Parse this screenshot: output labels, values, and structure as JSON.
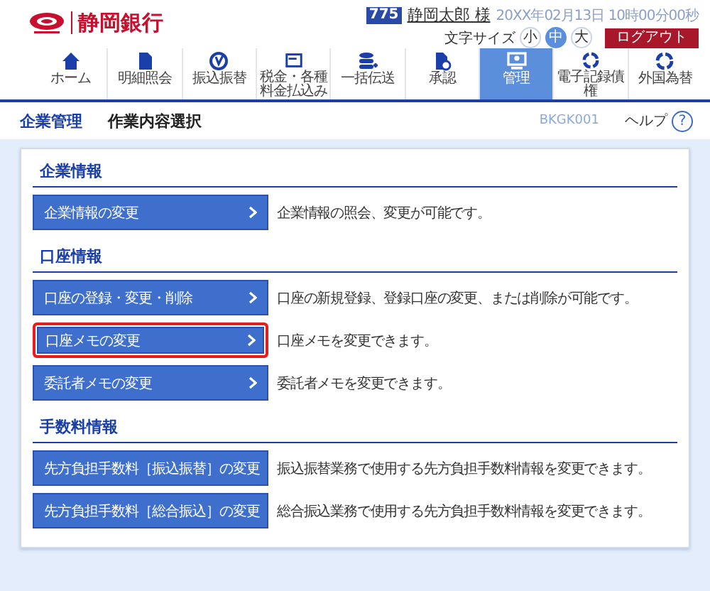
{
  "header": {
    "bank_name": "静岡銀行",
    "user_badge": "775",
    "user_name": "静岡太郎 様",
    "datetime": "20XX年02月13日 10時00分00秒",
    "font_size": {
      "label": "文字サイズ",
      "options": [
        {
          "label": "小",
          "selected": false
        },
        {
          "label": "中",
          "selected": true
        },
        {
          "label": "大",
          "selected": false
        }
      ]
    },
    "logout": "ログアウト"
  },
  "nav": [
    {
      "label": "ホーム",
      "selected": false
    },
    {
      "label": "明細照会",
      "selected": false
    },
    {
      "label": "振込振替",
      "selected": false
    },
    {
      "label": "税金・各種料金払込み",
      "selected": false
    },
    {
      "label": "一括伝送",
      "selected": false
    },
    {
      "label": "承認",
      "selected": false
    },
    {
      "label": "管理",
      "selected": true
    },
    {
      "label": "電子記録債権",
      "selected": false
    },
    {
      "label": "外国為替",
      "selected": false
    }
  ],
  "breadcrumb": {
    "section": "企業管理",
    "page": "作業内容選択",
    "screen_id": "BKGK001",
    "help": "ヘルプ",
    "help_icon": "?"
  },
  "sections": [
    {
      "title": "企業情報",
      "items": [
        {
          "label": "企業情報の変更",
          "description": "企業情報の照会、変更が可能です。",
          "highlighted": false
        }
      ]
    },
    {
      "title": "口座情報",
      "items": [
        {
          "label": "口座の登録・変更・削除",
          "description": "口座の新規登録、登録口座の変更、または削除が可能です。",
          "highlighted": false
        },
        {
          "label": "口座メモの変更",
          "description": "口座メモを変更できます。",
          "highlighted": true
        },
        {
          "label": "委託者メモの変更",
          "description": "委託者メモを変更できます。",
          "highlighted": false
        }
      ]
    },
    {
      "title": "手数料情報",
      "items": [
        {
          "label": "先方負担手数料［振込振替］の変更",
          "description": "振込振替業務で使用する先方負担手数料情報を変更できます。",
          "highlighted": false
        },
        {
          "label": "先方負担手数料［総合振込］の変更",
          "description": "総合振込業務で使用する先方負担手数料情報を変更できます。",
          "highlighted": false
        }
      ]
    }
  ]
}
